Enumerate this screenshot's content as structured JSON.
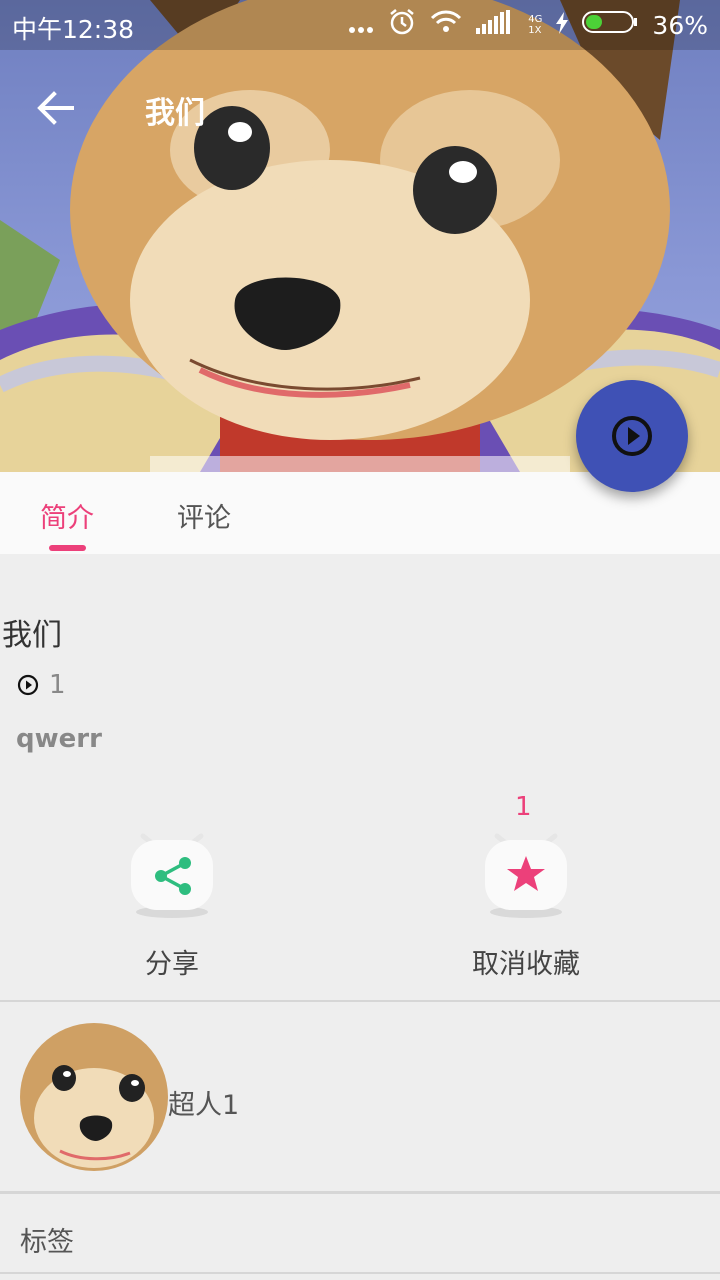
{
  "status_bar": {
    "time": "中午12:38",
    "battery": "36%",
    "net_top": "4G",
    "net_bottom": "1X"
  },
  "toolbar": {
    "title": "我们"
  },
  "tabs": [
    {
      "label": "简介",
      "active": true
    },
    {
      "label": "评论",
      "active": false
    }
  ],
  "info": {
    "title": "我们",
    "play_count": "1",
    "author": "qwerr"
  },
  "actions": {
    "share_label": "分享",
    "favorite_label": "取消收藏",
    "favorite_count": "1"
  },
  "uploader": {
    "name": "超人1"
  },
  "tags": {
    "label": "标签"
  },
  "colors": {
    "accent": "#ec407a",
    "fab": "#3f51b5",
    "share_green": "#2ebd7f",
    "background": "#eeeeee"
  }
}
